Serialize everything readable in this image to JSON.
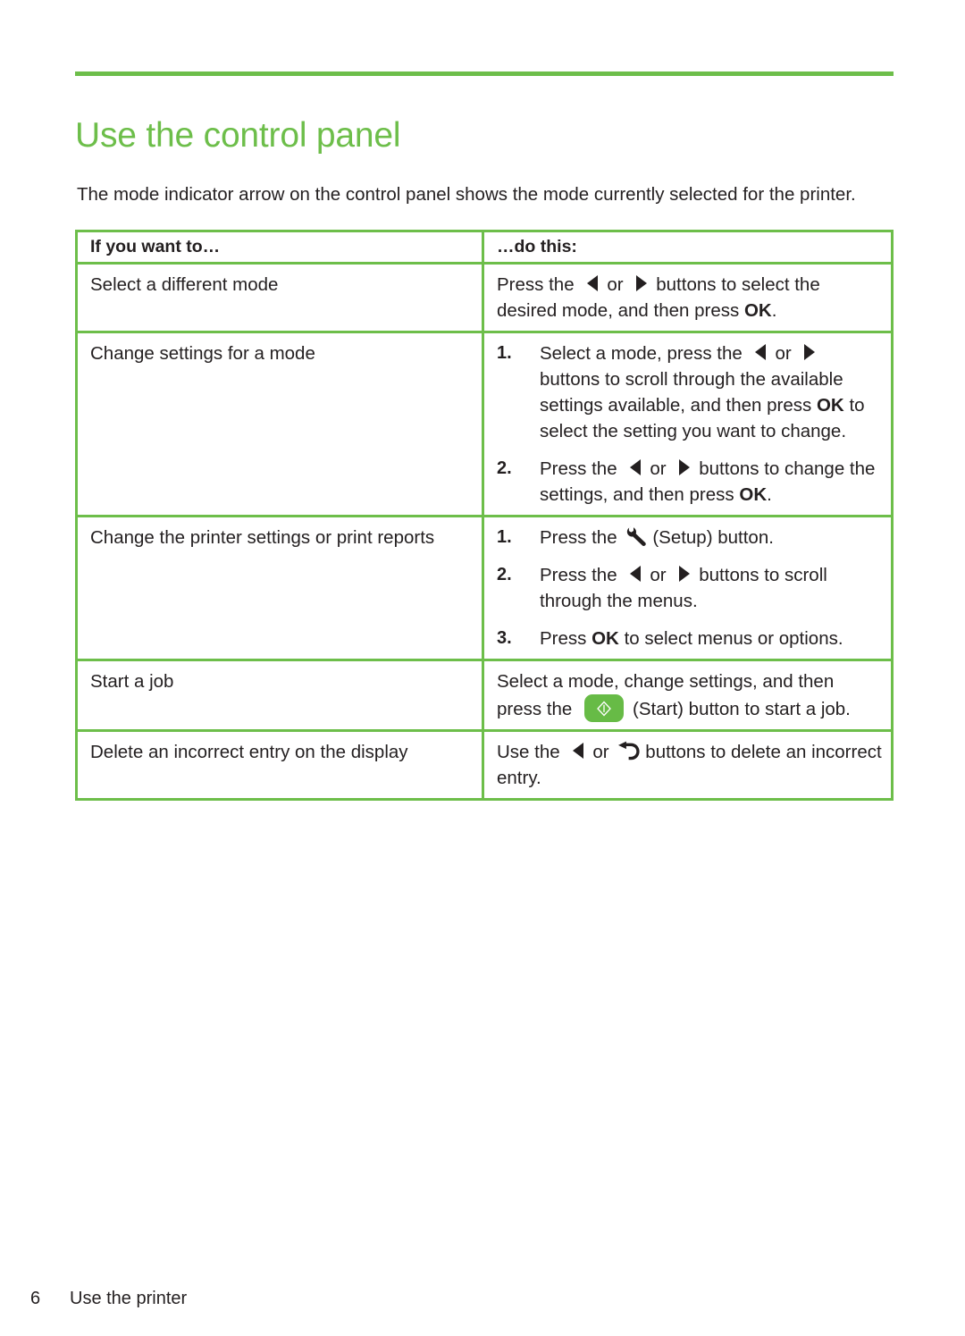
{
  "colors": {
    "accent_green": "#6dbe4a",
    "start_button_green": "#67bb46",
    "text": "#231f20"
  },
  "heading": "Use the control panel",
  "intro": "The mode indicator arrow on the control panel shows the mode currently selected for the printer.",
  "table": {
    "headers": {
      "left": "If you want to…",
      "right": "…do this:"
    },
    "rows": [
      {
        "left": "Select a different mode",
        "right_kind": "paragraph",
        "right_parts": [
          {
            "t": "text",
            "v": "Press the"
          },
          {
            "t": "icon",
            "v": "left-arrow-icon"
          },
          {
            "t": "text",
            "v": "or"
          },
          {
            "t": "icon",
            "v": "right-arrow-icon"
          },
          {
            "t": "text",
            "v": "buttons to select the desired mode, and then press"
          },
          {
            "t": "bold",
            "v": "OK"
          },
          {
            "t": "text",
            "v": "."
          }
        ]
      },
      {
        "left": "Change settings for a mode",
        "right_kind": "list",
        "items": [
          {
            "marker": "1.",
            "parts": [
              {
                "t": "text",
                "v": "Select a mode, press the"
              },
              {
                "t": "icon",
                "v": "left-arrow-icon"
              },
              {
                "t": "text",
                "v": "or"
              },
              {
                "t": "icon",
                "v": "right-arrow-icon"
              },
              {
                "t": "text",
                "v": "buttons to scroll through the available settings available, and then press"
              },
              {
                "t": "bold",
                "v": "OK"
              },
              {
                "t": "text",
                "v": "to select the setting you want to change."
              }
            ]
          },
          {
            "marker": "2.",
            "parts": [
              {
                "t": "text",
                "v": "Press the"
              },
              {
                "t": "icon",
                "v": "left-arrow-icon"
              },
              {
                "t": "text",
                "v": "or"
              },
              {
                "t": "icon",
                "v": "right-arrow-icon"
              },
              {
                "t": "text",
                "v": "buttons to change the settings, and then press"
              },
              {
                "t": "bold",
                "v": "OK"
              },
              {
                "t": "text",
                "v": "."
              }
            ]
          }
        ]
      },
      {
        "left": "Change the printer settings or print reports",
        "right_kind": "list",
        "items": [
          {
            "marker": "1.",
            "parts": [
              {
                "t": "text",
                "v": "Press the"
              },
              {
                "t": "icon",
                "v": "wrench-setup-icon"
              },
              {
                "t": "text",
                "v": "(Setup) button."
              }
            ]
          },
          {
            "marker": "2.",
            "parts": [
              {
                "t": "text",
                "v": "Press the"
              },
              {
                "t": "icon",
                "v": "left-arrow-icon"
              },
              {
                "t": "text",
                "v": "or"
              },
              {
                "t": "icon",
                "v": "right-arrow-icon"
              },
              {
                "t": "text",
                "v": "buttons to scroll through the menus."
              }
            ]
          },
          {
            "marker": "3.",
            "parts": [
              {
                "t": "text",
                "v": "Press"
              },
              {
                "t": "bold",
                "v": "OK"
              },
              {
                "t": "text",
                "v": "to select menus or options."
              }
            ]
          }
        ]
      },
      {
        "left": "Start a job",
        "right_kind": "paragraph",
        "right_parts": [
          {
            "t": "text",
            "v": "Select a mode, change settings, and then press  the"
          },
          {
            "t": "icon",
            "v": "start-button-icon"
          },
          {
            "t": "text",
            "v": "(Start) button to start a job."
          }
        ]
      },
      {
        "left": "Delete an incorrect entry on the display",
        "right_kind": "paragraph",
        "right_parts": [
          {
            "t": "text",
            "v": "Use the"
          },
          {
            "t": "icon",
            "v": "left-arrow-icon"
          },
          {
            "t": "text",
            "v": "or"
          },
          {
            "t": "icon",
            "v": "back-arrow-icon"
          },
          {
            "t": "text",
            "v": "buttons to delete an incorrect entry."
          }
        ]
      }
    ]
  },
  "footer": {
    "page_number": "6",
    "section": "Use the printer"
  }
}
